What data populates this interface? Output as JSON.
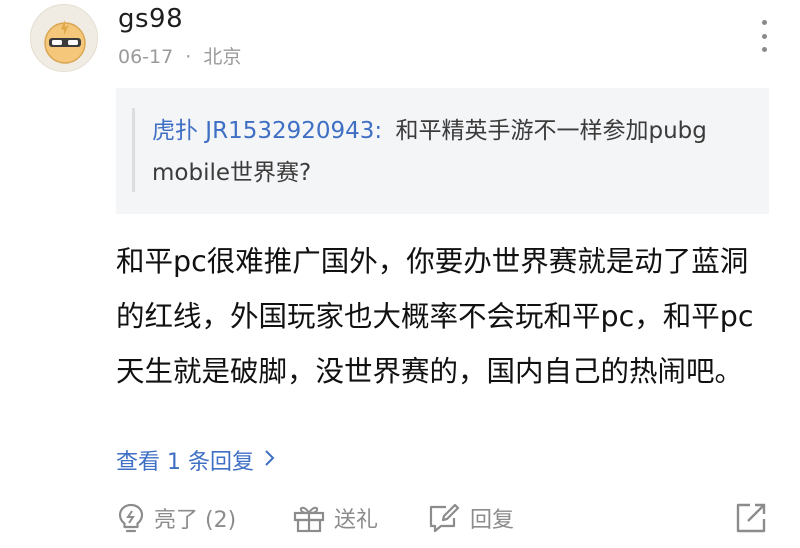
{
  "post": {
    "username": "gs98",
    "date": "06-17",
    "separator": "·",
    "location": "北京",
    "quote": {
      "author": "虎扑 JR1532920943:",
      "text": "和平精英手游不一样参加pubg mobile世界赛?"
    },
    "body": "和平pc很难推广国外，你要办世界赛就是动了蓝洞的红线，外国玩家也大概率不会玩和平pc，和平pc天生就是破脚，没世界赛的，国内自己的热闹吧。",
    "view_replies": "查看 1 条回复",
    "actions": {
      "like_label": "亮了 (2)",
      "gift_label": "送礼",
      "reply_label": "回复"
    }
  },
  "colors": {
    "link": "#3f6fc4",
    "meta": "#9a9a9a",
    "quote_bg": "#f4f5f7",
    "icon": "#8c8c8c"
  },
  "icons": [
    "avatar",
    "more-icon",
    "chevron-right-icon",
    "lightbulb-icon",
    "gift-icon",
    "reply-edit-icon",
    "share-icon"
  ]
}
